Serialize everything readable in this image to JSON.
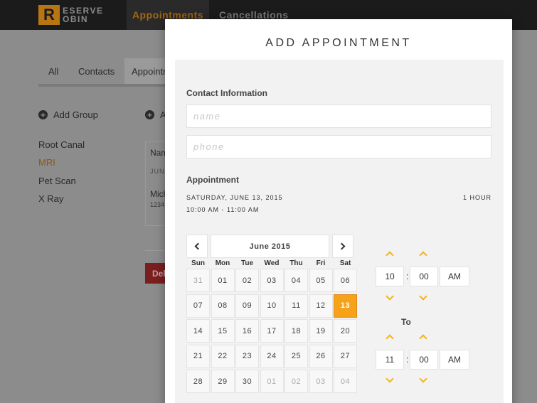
{
  "app": {
    "logo_letter": "R",
    "logo_text_line1": "ESERVE",
    "logo_text_line2": "OBIN",
    "nav": {
      "appointments": "Appointments",
      "cancellations": "Cancellations"
    }
  },
  "background": {
    "tabs": [
      "All",
      "Contacts",
      "Appointm"
    ],
    "add_group": "Add Group",
    "groups": [
      "Root Canal",
      "MRI",
      "Pet Scan",
      "X Ray"
    ],
    "active_group": "MRI",
    "add_appt_partial": "A",
    "table_header": "Nam",
    "table_subheader": "JUN",
    "row_name": "Mich",
    "row_phone": "1234",
    "delete_partial": "Del"
  },
  "modal": {
    "title": "ADD APPOINTMENT",
    "contact_section": "Contact Information",
    "name_placeholder": "name",
    "phone_placeholder": "phone",
    "appointment_section": "Appointment",
    "summary_date": "SATURDAY, JUNE 13, 2015",
    "summary_time": "10:00 AM - 11:00 AM",
    "summary_duration": "1 HOUR",
    "calendar": {
      "month_label": "June 2015",
      "weekdays": [
        "Sun",
        "Mon",
        "Tue",
        "Wed",
        "Thu",
        "Fri",
        "Sat"
      ],
      "days": [
        {
          "d": "31",
          "muted": true
        },
        {
          "d": "01"
        },
        {
          "d": "02"
        },
        {
          "d": "03"
        },
        {
          "d": "04"
        },
        {
          "d": "05"
        },
        {
          "d": "06"
        },
        {
          "d": "07"
        },
        {
          "d": "08"
        },
        {
          "d": "09"
        },
        {
          "d": "10"
        },
        {
          "d": "11"
        },
        {
          "d": "12"
        },
        {
          "d": "13",
          "selected": true
        },
        {
          "d": "14"
        },
        {
          "d": "15"
        },
        {
          "d": "16"
        },
        {
          "d": "17"
        },
        {
          "d": "18"
        },
        {
          "d": "19"
        },
        {
          "d": "20"
        },
        {
          "d": "21"
        },
        {
          "d": "22"
        },
        {
          "d": "23"
        },
        {
          "d": "24"
        },
        {
          "d": "25"
        },
        {
          "d": "26"
        },
        {
          "d": "27"
        },
        {
          "d": "28"
        },
        {
          "d": "29"
        },
        {
          "d": "30"
        },
        {
          "d": "01",
          "muted": true
        },
        {
          "d": "02",
          "muted": true
        },
        {
          "d": "03",
          "muted": true
        },
        {
          "d": "04",
          "muted": true
        }
      ]
    },
    "start_time": {
      "hour": "10",
      "minute": "00",
      "period": "AM"
    },
    "to_label": "To",
    "end_time": {
      "hour": "11",
      "minute": "00",
      "period": "AM"
    }
  },
  "colors": {
    "accent": "#f7a21b",
    "arrow": "#f2b31c",
    "topbar": "#1b1b1b"
  }
}
